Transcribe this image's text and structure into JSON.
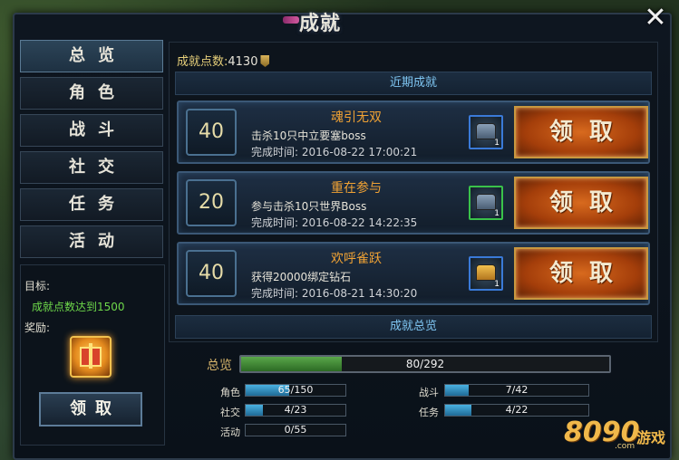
{
  "window": {
    "title": "成就",
    "close_label": "✕"
  },
  "nav": {
    "items": [
      {
        "label": "总览",
        "active": true
      },
      {
        "label": "角色"
      },
      {
        "label": "战斗"
      },
      {
        "label": "社交"
      },
      {
        "label": "任务"
      },
      {
        "label": "活动"
      }
    ]
  },
  "goal": {
    "target_label": "目标:",
    "target_value": "成就点数达到1500",
    "reward_label": "奖励:",
    "reward_icon": "gift-icon",
    "claim_label": "领取"
  },
  "points": {
    "label": "成就点数:",
    "value": "4130"
  },
  "recent": {
    "title": "近期成就",
    "items": [
      {
        "score": "40",
        "name": "魂引无双",
        "desc": "击杀10只中立要塞boss",
        "time": "完成时间: 2016-08-22 17:00:21",
        "item_count": "1",
        "item_border": "blue",
        "claim": "领取"
      },
      {
        "score": "20",
        "name": "重在参与",
        "desc": "参与击杀10只世界Boss",
        "time": "完成时间: 2016-08-22 14:22:35",
        "item_count": "1",
        "item_border": "green",
        "claim": "领取"
      },
      {
        "score": "40",
        "name": "欢呼雀跃",
        "desc": "获得20000绑定钻石",
        "time": "完成时间: 2016-08-21 14:30:20",
        "item_count": "1",
        "item_border": "blue",
        "claim": "领取"
      }
    ]
  },
  "overview": {
    "title": "成就总览",
    "total_label": "总览",
    "total_text": "80/292",
    "total_current": 80,
    "total_max": 292,
    "categories": [
      {
        "label": "角色",
        "text": "65/150",
        "current": 65,
        "max": 150
      },
      {
        "label": "战斗",
        "text": "7/42",
        "current": 7,
        "max": 42
      },
      {
        "label": "社交",
        "text": "4/23",
        "current": 4,
        "max": 23
      },
      {
        "label": "任务",
        "text": "4/22",
        "current": 4,
        "max": 22
      },
      {
        "label": "活动",
        "text": "0/55",
        "current": 0,
        "max": 55
      }
    ]
  },
  "watermark": {
    "number": "8090",
    "game": "游戏",
    "domain": ".com"
  }
}
